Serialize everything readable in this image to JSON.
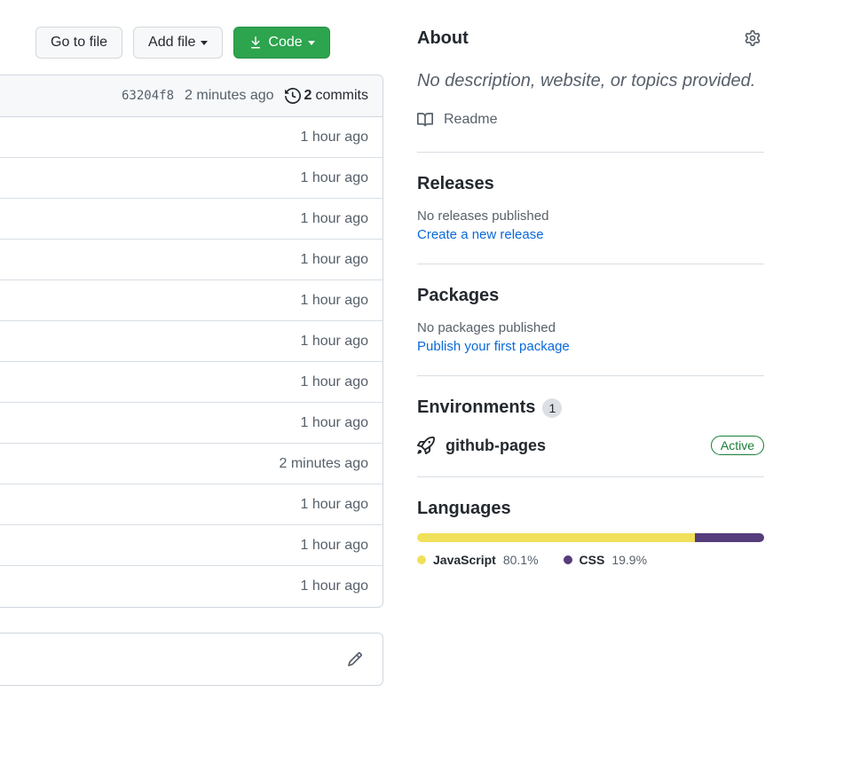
{
  "actions": {
    "go_to_file": "Go to file",
    "add_file": "Add file",
    "code": "Code"
  },
  "commit_header": {
    "sha": "63204f8",
    "time": "2 minutes ago",
    "commit_count": "2",
    "commits_word": "commits"
  },
  "file_rows": [
    {
      "time": "1 hour ago"
    },
    {
      "time": "1 hour ago"
    },
    {
      "time": "1 hour ago"
    },
    {
      "time": "1 hour ago"
    },
    {
      "time": "1 hour ago"
    },
    {
      "time": "1 hour ago"
    },
    {
      "time": "1 hour ago"
    },
    {
      "time": "1 hour ago"
    },
    {
      "time": "2 minutes ago"
    },
    {
      "time": "1 hour ago"
    },
    {
      "time": "1 hour ago"
    },
    {
      "time": "1 hour ago"
    }
  ],
  "about": {
    "heading": "About",
    "description": "No description, website, or topics provided.",
    "readme_label": "Readme"
  },
  "releases": {
    "heading": "Releases",
    "empty_text": "No releases published",
    "cta": "Create a new release"
  },
  "packages": {
    "heading": "Packages",
    "empty_text": "No packages published",
    "cta": "Publish your first package"
  },
  "environments": {
    "heading": "Environments",
    "count": "1",
    "name": "github-pages",
    "status": "Active"
  },
  "languages": {
    "heading": "Languages",
    "items": [
      {
        "name": "JavaScript",
        "percent": "80.1%",
        "color": "#f1e05a"
      },
      {
        "name": "CSS",
        "percent": "19.9%",
        "color": "#563d7c"
      }
    ]
  }
}
